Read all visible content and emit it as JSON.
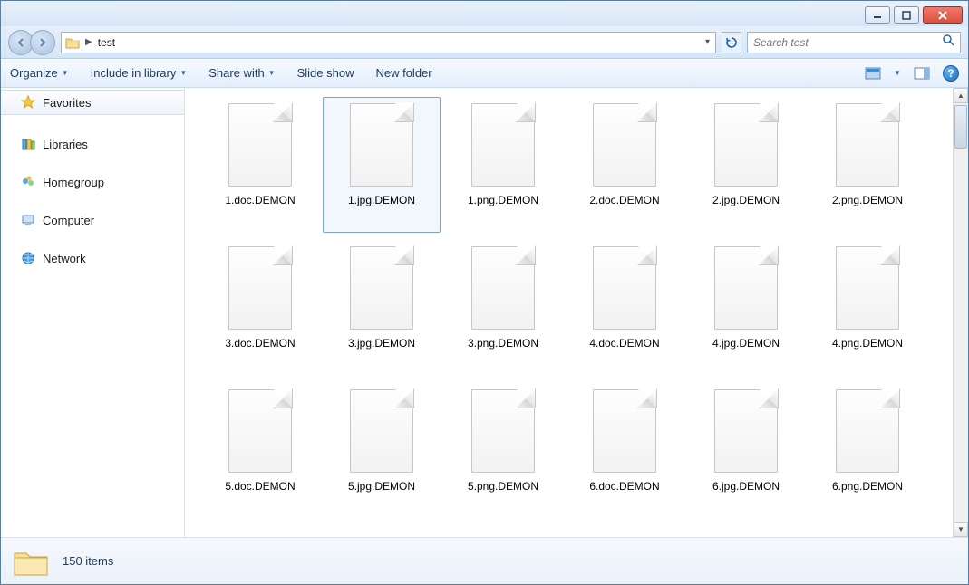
{
  "window": {
    "controls": {
      "min": "minimize",
      "max": "maximize",
      "close": "close"
    }
  },
  "address": {
    "folder": "test"
  },
  "search": {
    "placeholder": "Search test"
  },
  "toolbar": {
    "organize": "Organize",
    "include": "Include in library",
    "share": "Share with",
    "slideshow": "Slide show",
    "newfolder": "New folder"
  },
  "sidebar": {
    "favorites": "Favorites",
    "libraries": "Libraries",
    "homegroup": "Homegroup",
    "computer": "Computer",
    "network": "Network"
  },
  "files": [
    {
      "name": "1.doc.DEMON",
      "selected": false
    },
    {
      "name": "1.jpg.DEMON",
      "selected": true
    },
    {
      "name": "1.png.DEMON",
      "selected": false
    },
    {
      "name": "2.doc.DEMON",
      "selected": false
    },
    {
      "name": "2.jpg.DEMON",
      "selected": false
    },
    {
      "name": "2.png.DEMON",
      "selected": false
    },
    {
      "name": "3.doc.DEMON",
      "selected": false
    },
    {
      "name": "3.jpg.DEMON",
      "selected": false
    },
    {
      "name": "3.png.DEMON",
      "selected": false
    },
    {
      "name": "4.doc.DEMON",
      "selected": false
    },
    {
      "name": "4.jpg.DEMON",
      "selected": false
    },
    {
      "name": "4.png.DEMON",
      "selected": false
    },
    {
      "name": "5.doc.DEMON",
      "selected": false
    },
    {
      "name": "5.jpg.DEMON",
      "selected": false
    },
    {
      "name": "5.png.DEMON",
      "selected": false
    },
    {
      "name": "6.doc.DEMON",
      "selected": false
    },
    {
      "name": "6.jpg.DEMON",
      "selected": false
    },
    {
      "name": "6.png.DEMON",
      "selected": false
    }
  ],
  "status": {
    "count": "150 items"
  }
}
